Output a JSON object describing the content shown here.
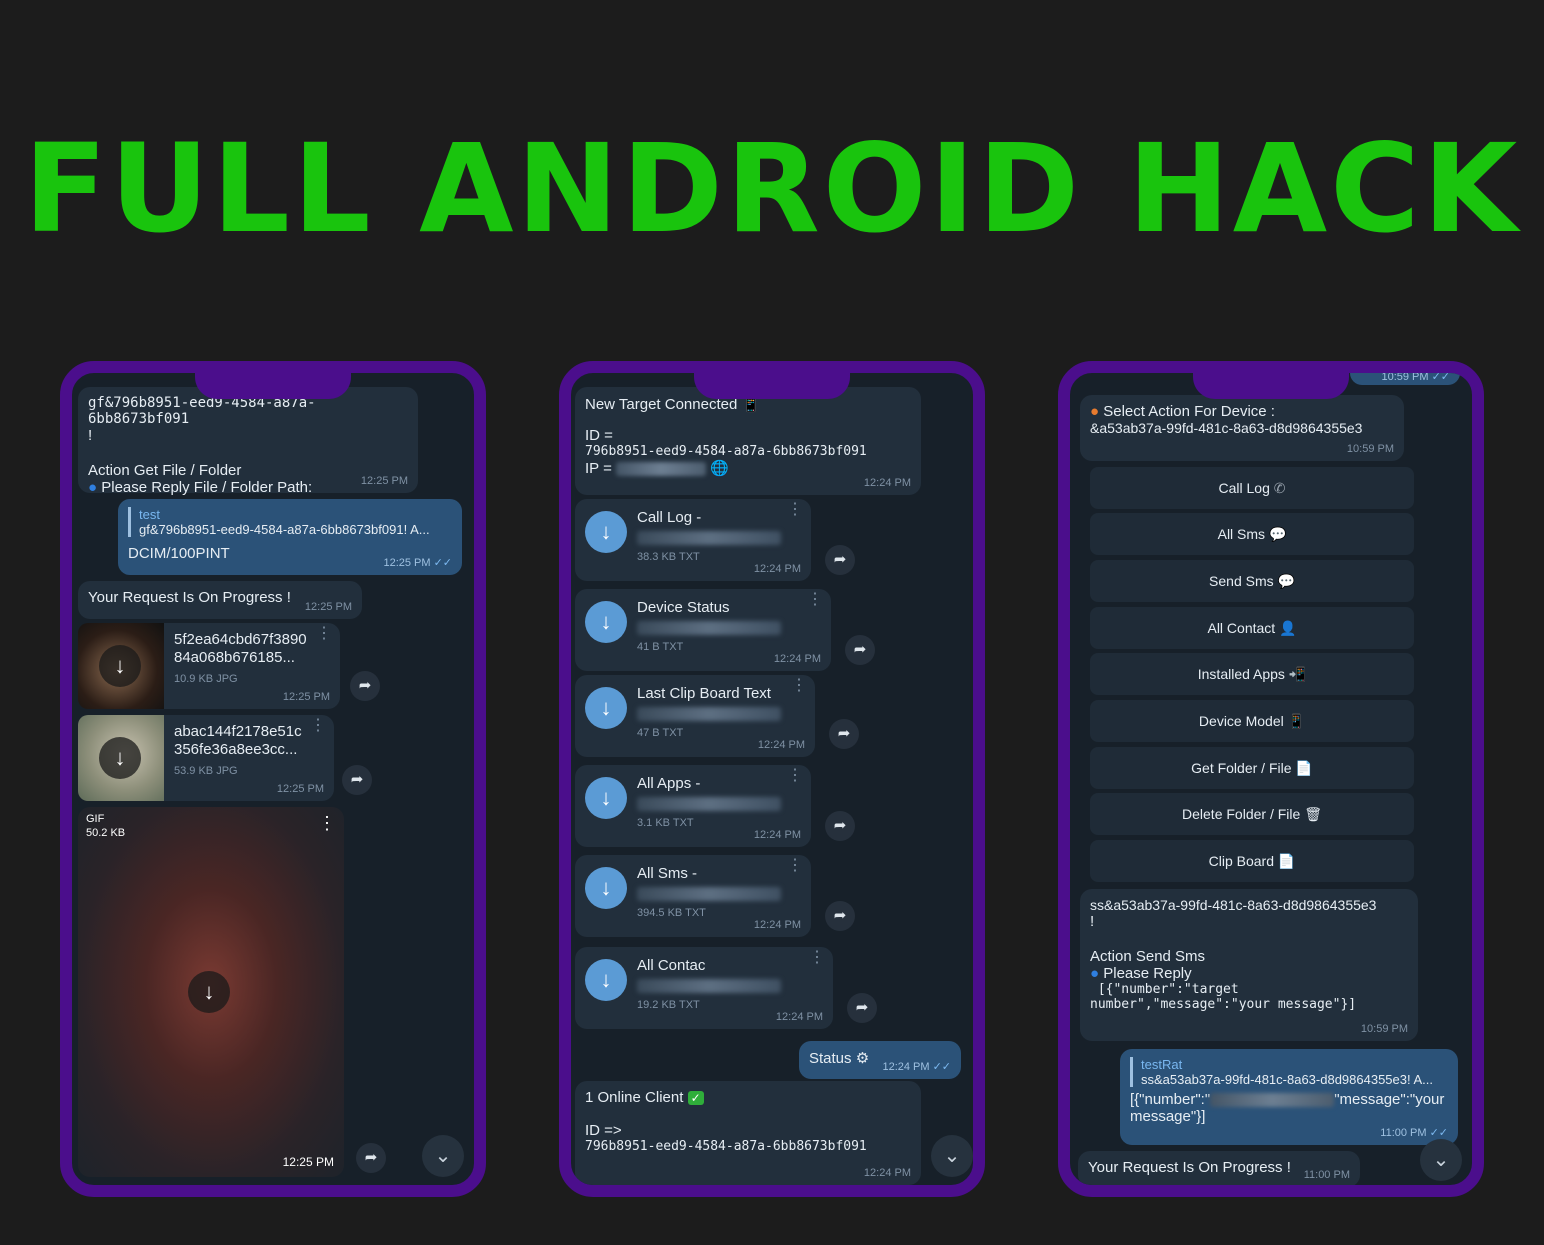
{
  "headline": "FULL ANDROID HACK",
  "colors": {
    "headline": "#19c40d",
    "frame": "#4b0e8c",
    "chat_bg": "#172029",
    "incoming": "#222f3c",
    "outgoing": "#2b5278",
    "download": "#5b9bd5"
  },
  "phone1": {
    "msg1": {
      "line1": "gf&796b8951-eed9-4584-a87a-6bb8673bf091",
      "line2": "!",
      "action": "Action Get File / Folder",
      "prompt": "Please Reply File / Folder Path:",
      "time": "12:25 PM"
    },
    "reply": {
      "quote_author": "test",
      "quote_text": "gf&796b8951-eed9-4584-a87a-6bb8673bf091! A...",
      "text": "DCIM/100PINT",
      "time": "12:25 PM"
    },
    "progress": {
      "text": "Your Request Is On Progress !",
      "time": "12:25 PM"
    },
    "file1": {
      "name1": "5f2ea64cbd67f3890",
      "name2": "84a068b676185...",
      "meta": "10.9 KB JPG",
      "time": "12:25 PM"
    },
    "file2": {
      "name1": "abac144f2178e51c",
      "name2": "356fe36a8ee3cc...",
      "meta": "53.9 KB JPG",
      "time": "12:25 PM"
    },
    "gif": {
      "label": "GIF",
      "size": "50.2 KB",
      "time": "12:25 PM"
    }
  },
  "phone2": {
    "msg1": {
      "title": "New Target Connected",
      "id_label": "ID =",
      "id": "796b8951-eed9-4584-a87a-6bb8673bf091",
      "ip_label": "IP =",
      "time": "12:24 PM"
    },
    "files": [
      {
        "name": "Call Log  -",
        "meta": "38.3 KB TXT",
        "time": "12:24 PM"
      },
      {
        "name": "Device Status",
        "meta": "41 B TXT",
        "time": "12:24 PM"
      },
      {
        "name": "Last Clip Board Text",
        "meta": "47 B TXT",
        "time": "12:24 PM"
      },
      {
        "name": "All Apps  -",
        "meta": "3.1 KB TXT",
        "time": "12:24 PM"
      },
      {
        "name": "All Sms  -",
        "meta": "394.5 KB TXT",
        "time": "12:24 PM"
      },
      {
        "name": "All Contac",
        "meta": "19.2 KB TXT",
        "time": "12:24 PM"
      }
    ],
    "status": {
      "text": "Status",
      "time": "12:24 PM"
    },
    "online": {
      "text": "1 Online Client",
      "id_label": "ID =>",
      "id": "796b8951-eed9-4584-a87a-6bb8673bf091",
      "time": "12:24 PM"
    }
  },
  "phone3": {
    "top_time": "10:59 PM",
    "select": {
      "title": "Select Action For Device :",
      "id": "&a53ab37a-99fd-481c-8a63-d8d9864355e3",
      "time": "10:59 PM"
    },
    "buttons": [
      "Call Log",
      "All Sms",
      "Send Sms",
      "All Contact",
      "Installed Apps",
      "Device Model",
      "Get Folder / File",
      "Delete Folder / File",
      "Clip Board"
    ],
    "send": {
      "line1": "ss&a53ab37a-99fd-481c-8a63-d8d9864355e3",
      "line2": "!",
      "action": "Action Send Sms",
      "prompt": "Please Reply",
      "code1": " [{\"number\":\"target",
      "code2": "number\",\"message\":\"your message\"}]",
      "time": "10:59 PM"
    },
    "reply": {
      "quote_author": "testRat",
      "quote_text": "ss&a53ab37a-99fd-481c-8a63-d8d9864355e3! A...",
      "text1": "[{\"number\":\"",
      "text2": "\"message\":\"your",
      "text3": "message\"}]",
      "time": "11:00 PM"
    },
    "progress": {
      "text": "Your Request Is On Progress !",
      "time": "11:00 PM"
    }
  }
}
